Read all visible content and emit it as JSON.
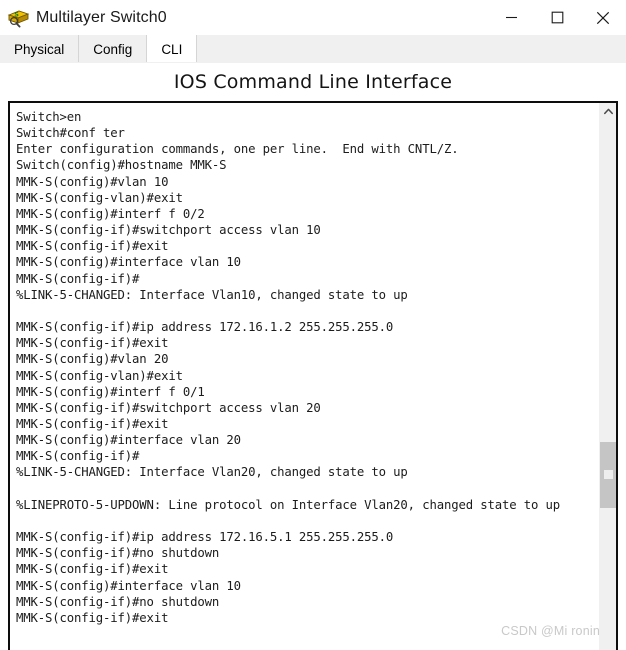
{
  "window": {
    "title": "Multilayer Switch0",
    "icon": "switch-device-icon",
    "controls": {
      "minimize_label": "Minimize",
      "maximize_label": "Maximize",
      "close_label": "Close"
    }
  },
  "tabs": [
    {
      "label": "Physical",
      "active": false
    },
    {
      "label": "Config",
      "active": false
    },
    {
      "label": "CLI",
      "active": true
    }
  ],
  "heading": "IOS Command Line Interface",
  "terminal": {
    "lines": [
      "Switch>en",
      "Switch#conf ter",
      "Enter configuration commands, one per line.  End with CNTL/Z.",
      "Switch(config)#hostname MMK-S",
      "MMK-S(config)#vlan 10",
      "MMK-S(config-vlan)#exit",
      "MMK-S(config)#interf f 0/2",
      "MMK-S(config-if)#switchport access vlan 10",
      "MMK-S(config-if)#exit",
      "MMK-S(config)#interface vlan 10",
      "MMK-S(config-if)#",
      "%LINK-5-CHANGED: Interface Vlan10, changed state to up",
      "",
      "MMK-S(config-if)#ip address 172.16.1.2 255.255.255.0",
      "MMK-S(config-if)#exit",
      "MMK-S(config)#vlan 20",
      "MMK-S(config-vlan)#exit",
      "MMK-S(config)#interf f 0/1",
      "MMK-S(config-if)#switchport access vlan 20",
      "MMK-S(config-if)#exit",
      "MMK-S(config)#interface vlan 20",
      "MMK-S(config-if)#",
      "%LINK-5-CHANGED: Interface Vlan20, changed state to up",
      "",
      "%LINEPROTO-5-UPDOWN: Line protocol on Interface Vlan20, changed state to up",
      "",
      "MMK-S(config-if)#ip address 172.16.5.1 255.255.255.0",
      "MMK-S(config-if)#no shutdown",
      "MMK-S(config-if)#exit",
      "MMK-S(config)#interface vlan 10",
      "MMK-S(config-if)#no shutdown",
      "MMK-S(config-if)#exit"
    ]
  },
  "scrollbar": {
    "up_arrow": "chevron-up-icon",
    "thumb_top_pct": 62,
    "thumb_height_pct": 12
  },
  "watermark": "CSDN @Mi ronin",
  "colors": {
    "window_bg": "#ffffff",
    "tab_inactive_bg": "#f0f0f0",
    "tab_active_bg": "#ffffff",
    "terminal_border": "#0d0d0d",
    "terminal_text": "#1c1c1c",
    "scrollbar_track": "#f0f0f0",
    "scrollbar_thumb": "#c5c5c5",
    "watermark_text": "#c9c9c9"
  }
}
